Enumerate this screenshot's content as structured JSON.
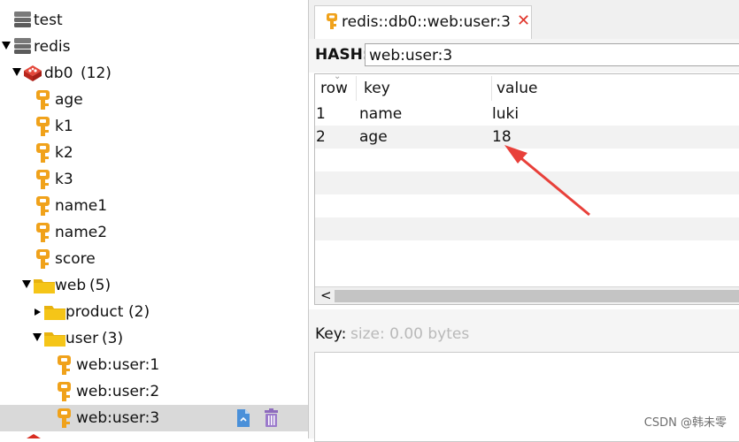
{
  "tree": {
    "connections": [
      {
        "label": "test"
      },
      {
        "label": "redis"
      }
    ],
    "db": {
      "label": "db0",
      "count": "(12)"
    },
    "keys": [
      "age",
      "k1",
      "k2",
      "k3",
      "name1",
      "name2",
      "score"
    ],
    "folder_web": {
      "label": "web",
      "count": "(5)"
    },
    "folder_product": {
      "label": "product",
      "count": "(2)"
    },
    "folder_user": {
      "label": "user",
      "count": "(3)"
    },
    "user_keys": [
      "web:user:1",
      "web:user:2",
      "web:user:3"
    ]
  },
  "tab": {
    "label": "redis::db0::web:user:3",
    "close_glyph": "✕"
  },
  "hash": {
    "type_label": "HASH:",
    "key_value": "web:user:3"
  },
  "table": {
    "columns": [
      "row",
      "key",
      "value"
    ],
    "rows": [
      {
        "row": "1",
        "key": "name",
        "value": "luki"
      },
      {
        "row": "2",
        "key": "age",
        "value": "18"
      }
    ],
    "scroll_left_glyph": "<"
  },
  "key_info": {
    "label": "Key:",
    "size_text": "size: 0.00 bytes"
  },
  "watermark": "CSDN @韩未零",
  "colors": {
    "key_icon": "#f0a21b",
    "folder": "#f5c518",
    "redis_red": "#d82c20",
    "annotation_arrow": "#e8403a",
    "selection": "#d9d9d9"
  }
}
